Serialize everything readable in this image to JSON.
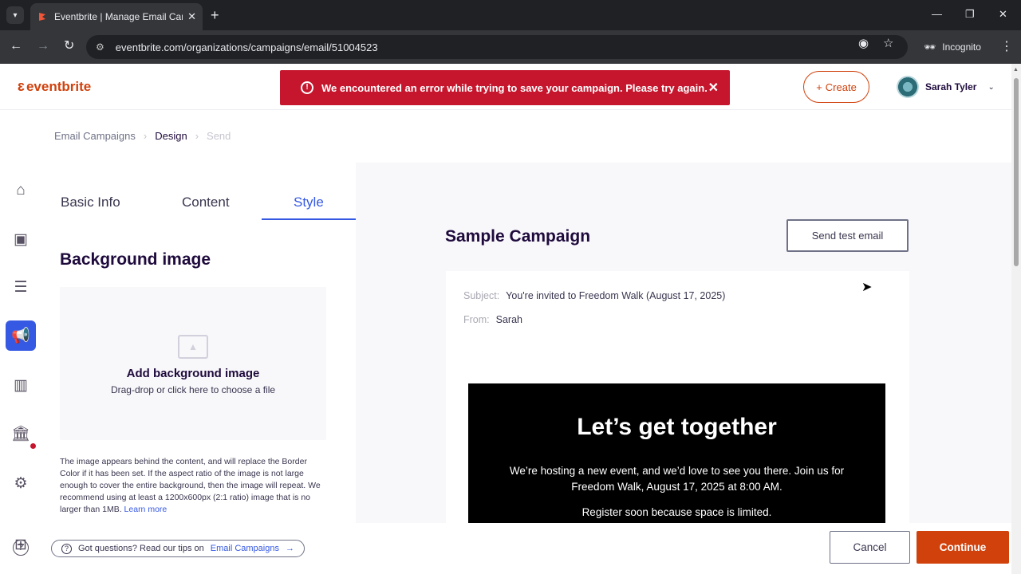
{
  "browser": {
    "tab_title": "Eventbrite | Manage Email Cam",
    "url": "eventbrite.com/organizations/campaigns/email/51004523",
    "incognito_label": "Incognito"
  },
  "header": {
    "logo": "eventbrite",
    "error_message": "We encountered an error while trying to save your campaign. Please try again.",
    "create_label": "Create",
    "user_name": "Sarah Tyler"
  },
  "breadcrumb": {
    "items": [
      "Email Campaigns",
      "Design",
      "Send"
    ]
  },
  "left_panel": {
    "tabs": [
      "Basic Info",
      "Content",
      "Style"
    ],
    "active_tab": "Style",
    "section_title": "Background image",
    "dropzone_title": "Add background image",
    "dropzone_sub": "Drag-drop or click here to choose a file",
    "help_text": "The image appears behind the content, and will replace the Border Color if it has been set. If the aspect ratio of the image is not large enough to cover the entire background, then the image will repeat. We recommend using at least a 1200x600px (2:1 ratio) image that is no larger than 1MB.",
    "learn_more": "Learn more"
  },
  "preview": {
    "campaign_title": "Sample Campaign",
    "test_email_label": "Send test email",
    "subject_label": "Subject:",
    "subject_value": "You're invited to Freedom Walk (August 17, 2025)",
    "from_label": "From:",
    "from_value": "Sarah",
    "hero_title": "Let’s get together",
    "hero_p1": "We’re hosting a new event, and we’d love to see you there. Join us for Freedom Walk, August 17, 2025 at 8:00 AM.",
    "hero_p2": "Register soon because space is limited."
  },
  "footer": {
    "tips_text": "Got questions? Read our tips on",
    "tips_link": "Email Campaigns",
    "cancel_label": "Cancel",
    "continue_label": "Continue"
  },
  "colors": {
    "brand": "#d1410c",
    "accent": "#3659e3",
    "error": "#c5162e"
  }
}
